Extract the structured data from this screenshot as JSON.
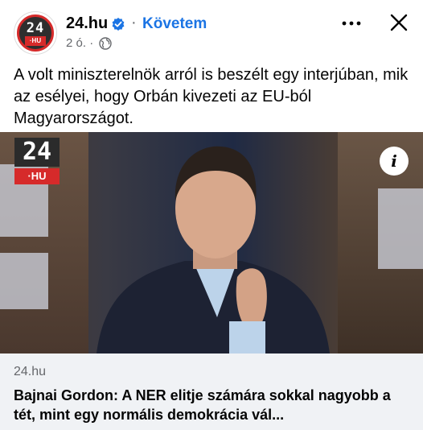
{
  "header": {
    "page_name": "24.hu",
    "follow_label": "Követem",
    "separator": "·",
    "timestamp": "2 ó.",
    "time_separator": "·"
  },
  "avatar": {
    "logo_number": "24",
    "logo_suffix": "·HU"
  },
  "post": {
    "text": "A volt miniszterelnök arról is beszélt egy interjúban, mik az esélyei, hogy Orbán kivezeti az EU-ból Magyarországot."
  },
  "media": {
    "logo_number": "24",
    "logo_suffix": "·HU",
    "info_label": "i"
  },
  "link": {
    "domain": "24.hu",
    "title": "Bajnai Gordon: A NER elitje számára sokkal nagyobb a tét, mint egy normális demokrácia vál..."
  },
  "icons": [
    "verified-badge-icon",
    "globe-icon",
    "more-options-icon",
    "close-icon",
    "info-icon"
  ],
  "colors": {
    "accent": "#1b74e4",
    "brand_red": "#d62a2a",
    "secondary_text": "#65676b",
    "link_card_bg": "#f0f2f5"
  }
}
